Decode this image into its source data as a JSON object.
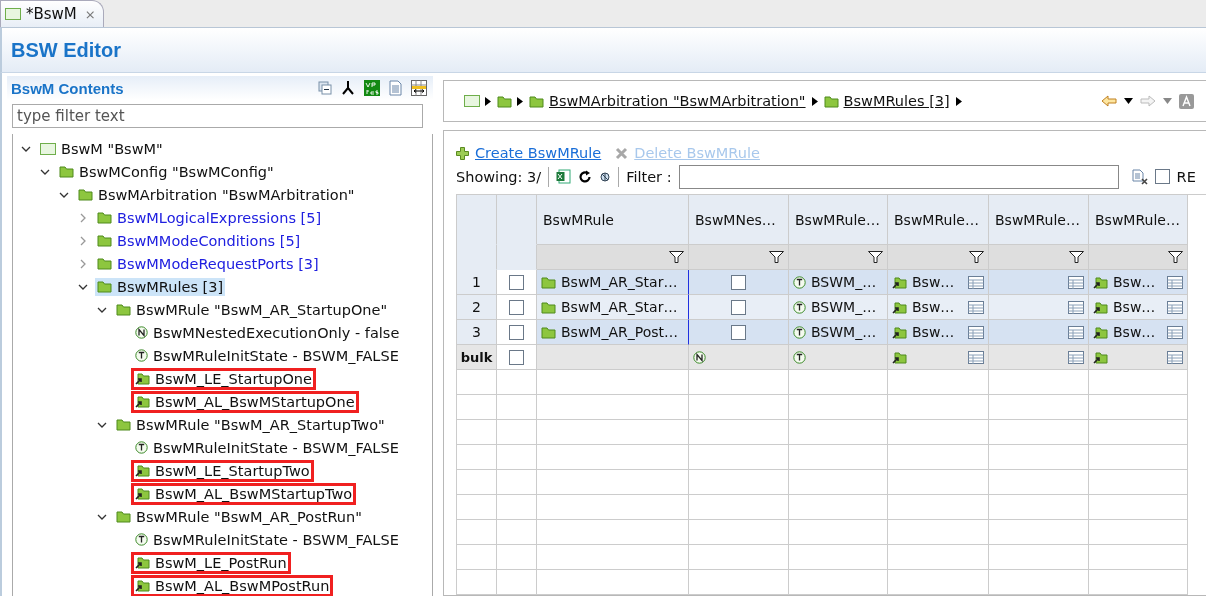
{
  "tab": {
    "title": "*BswM",
    "close": "⨯"
  },
  "editor_title": "BSW Editor",
  "contents": {
    "title": "BswM Contents",
    "filter_placeholder": "type filter text",
    "tree": [
      {
        "label": "BswM \"BswM\"",
        "kind": "module",
        "expanded": true,
        "selected": false,
        "children": [
          {
            "label": "BswMConfig \"BswMConfig\"",
            "kind": "folder",
            "expanded": true,
            "selected": false,
            "children": [
              {
                "label": "BswMArbitration \"BswMArbitration\"",
                "kind": "folder",
                "expanded": true,
                "selected": false,
                "children": [
                  {
                    "label": "BswMLogicalExpressions [5]",
                    "kind": "folder",
                    "expanded": false,
                    "selected": false
                  },
                  {
                    "label": "BswMModeConditions [5]",
                    "kind": "folder",
                    "expanded": false,
                    "selected": false
                  },
                  {
                    "label": "BswMModeRequestPorts [3]",
                    "kind": "folder",
                    "expanded": false,
                    "selected": false
                  },
                  {
                    "label": "BswMRules [3]",
                    "kind": "folder",
                    "expanded": true,
                    "selected": true,
                    "children": [
                      {
                        "label": "BswMRule \"BswM_AR_StartupOne\"",
                        "kind": "folder",
                        "expanded": true,
                        "selected": false,
                        "children": [
                          {
                            "label": "BswMNestedExecutionOnly - false",
                            "kind": "number",
                            "selected": false
                          },
                          {
                            "label": "BswMRuleInitState - BSWM_FALSE",
                            "kind": "text",
                            "selected": false
                          },
                          {
                            "label": "BswM_LE_StartupOne",
                            "kind": "reference",
                            "selected": false,
                            "annotated": true
                          },
                          {
                            "label": "BswM_AL_BswMStartupOne",
                            "kind": "reference",
                            "selected": false,
                            "annotated": true
                          }
                        ]
                      },
                      {
                        "label": "BswMRule \"BswM_AR_StartupTwo\"",
                        "kind": "folder",
                        "expanded": true,
                        "selected": false,
                        "children": [
                          {
                            "label": "BswMRuleInitState - BSWM_FALSE",
                            "kind": "text",
                            "selected": false
                          },
                          {
                            "label": "BswM_LE_StartupTwo",
                            "kind": "reference",
                            "selected": false,
                            "annotated": true
                          },
                          {
                            "label": "BswM_AL_BswMStartupTwo",
                            "kind": "reference",
                            "selected": false,
                            "annotated": true
                          }
                        ]
                      },
                      {
                        "label": "BswMRule \"BswM_AR_PostRun\"",
                        "kind": "folder",
                        "expanded": true,
                        "selected": false,
                        "children": [
                          {
                            "label": "BswMRuleInitState - BSWM_FALSE",
                            "kind": "text",
                            "selected": false
                          },
                          {
                            "label": "BswM_LE_PostRun",
                            "kind": "reference",
                            "selected": false,
                            "annotated": true
                          },
                          {
                            "label": "BswM_AL_BswMPostRun",
                            "kind": "reference",
                            "selected": false,
                            "annotated": true
                          }
                        ]
                      }
                    ]
                  }
                ]
              }
            ]
          }
        ]
      }
    ]
  },
  "breadcrumb": [
    {
      "kind": "module"
    },
    {
      "kind": "folder"
    },
    {
      "label": "BswMArbitration \"BswMArbitration\"",
      "kind": "folder"
    },
    {
      "label": "BswMRules [3]",
      "kind": "folder"
    }
  ],
  "actions": [
    {
      "label": "Create BswMRule",
      "kind": "create",
      "disabled": false
    },
    {
      "label": "Delete BswMRule",
      "kind": "delete",
      "disabled": true
    }
  ],
  "showing": "Showing: 3/",
  "filter_label": "Filter :",
  "regex": {
    "label": "RE",
    "checked": false
  },
  "table": {
    "columns": [
      "BswMRule",
      "BswMNes…",
      "BswMRule…",
      "BswMRule…",
      "BswMRule…",
      "BswMRule…"
    ],
    "rows": [
      {
        "index": "1",
        "checked": false,
        "cells": [
          {
            "kind": "folder",
            "text": "BswM_AR_Star…"
          },
          {
            "kind": "check",
            "checked": false
          },
          {
            "kind": "text",
            "text": "BSWM_…"
          },
          {
            "kind": "reference",
            "text": "Bsw…"
          },
          {
            "kind": "reference"
          },
          {
            "kind": "reference",
            "text": "Bsw…"
          }
        ]
      },
      {
        "index": "2",
        "checked": false,
        "cells": [
          {
            "kind": "folder",
            "text": "BswM_AR_Star…"
          },
          {
            "kind": "check",
            "checked": false
          },
          {
            "kind": "text",
            "text": "BSWM_…"
          },
          {
            "kind": "reference",
            "text": "Bsw…"
          },
          {
            "kind": "reference"
          },
          {
            "kind": "reference",
            "text": "Bsw…"
          }
        ]
      },
      {
        "index": "3",
        "checked": false,
        "cells": [
          {
            "kind": "folder",
            "text": "BswM_AR_Post…"
          },
          {
            "kind": "check",
            "checked": false
          },
          {
            "kind": "text",
            "text": "BSWM_…"
          },
          {
            "kind": "reference",
            "text": "Bsw…"
          },
          {
            "kind": "reference"
          },
          {
            "kind": "reference",
            "text": "Bsw…"
          }
        ]
      }
    ],
    "bulk": {
      "label": "bulk",
      "checked": false,
      "cells": [
        {
          "kind": "empty"
        },
        {
          "kind": "number"
        },
        {
          "kind": "text"
        },
        {
          "kind": "reference"
        },
        {
          "kind": "table"
        },
        {
          "kind": "reference"
        }
      ]
    }
  }
}
